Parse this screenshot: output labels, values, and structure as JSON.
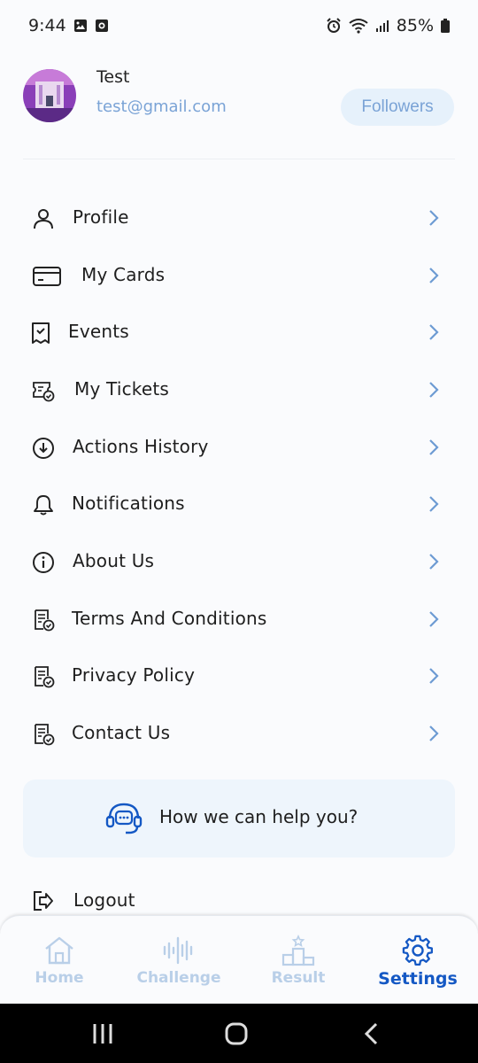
{
  "status_bar": {
    "time": "9:44",
    "battery": "85%"
  },
  "profile": {
    "name": "Test",
    "email": "test@gmail.com",
    "followers_label": "Followers"
  },
  "menu": {
    "items": [
      {
        "label": "Profile",
        "icon": "user-icon"
      },
      {
        "label": "My Cards",
        "icon": "card-icon"
      },
      {
        "label": "Events",
        "icon": "event-ticket-icon"
      },
      {
        "label": "My Tickets",
        "icon": "tickets-icon"
      },
      {
        "label": "Actions History",
        "icon": "download-circle-icon"
      },
      {
        "label": "Notifications",
        "icon": "bell-icon"
      },
      {
        "label": "About Us",
        "icon": "info-icon"
      },
      {
        "label": "Terms And Conditions",
        "icon": "document-check-icon"
      },
      {
        "label": "Privacy Policy",
        "icon": "document-check-icon"
      },
      {
        "label": "Contact Us",
        "icon": "document-check-icon"
      }
    ]
  },
  "help": {
    "label": "How we can help you?",
    "icon": "support-headset-icon"
  },
  "logout": {
    "label": "Logout",
    "icon": "logout-icon"
  },
  "bottom_nav": {
    "items": [
      {
        "label": "Home",
        "icon": "home-icon",
        "active": false
      },
      {
        "label": "Challenge",
        "icon": "audio-wave-icon",
        "active": false
      },
      {
        "label": "Result",
        "icon": "podium-icon",
        "active": false
      },
      {
        "label": "Settings",
        "icon": "gear-icon",
        "active": true
      }
    ]
  },
  "colors": {
    "accent": "#1458c4",
    "muted_blue": "#7aa3d6",
    "inactive_nav": "#b9cfe8",
    "help_bg": "#eef5fc",
    "followers_bg": "#e6f1fb"
  }
}
